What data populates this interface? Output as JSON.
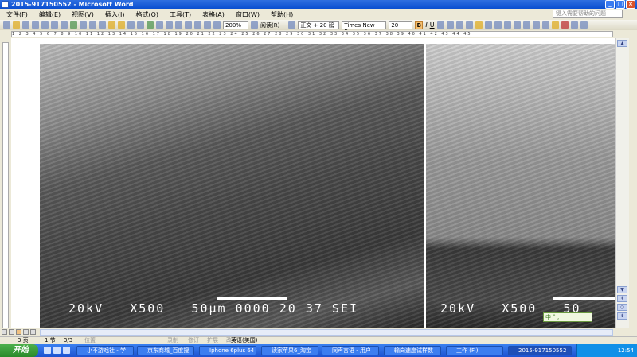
{
  "window": {
    "title": "2015-917150552 - Microsoft Word"
  },
  "menu": [
    "文件(F)",
    "编辑(E)",
    "视图(V)",
    "插入(I)",
    "格式(O)",
    "工具(T)",
    "表格(A)",
    "窗口(W)",
    "帮助(H)"
  ],
  "help_placeholder": "键入需要帮助的问题",
  "toolbar": {
    "zoom": "200%",
    "read": "阅读(R)",
    "style": "正文 + 20 磅",
    "font": "Times New Roman",
    "size": "20",
    "bold": "B",
    "italic": "I",
    "underline": "U"
  },
  "ruler": {
    "ticks": "1 2 3 4 5 6 7 8 9 10 11 12 13 14 15 16 17 18 19 20 21 22 23 24 25 26 27 28 29 30 31 32 33 34 35 36 37 38 39 40 41 42 43 44 45"
  },
  "images": [
    {
      "caption": "20kV   X500   50μm 0000 20 37 SEI"
    },
    {
      "caption": "20kV   X500   50"
    }
  ],
  "ime": "中 ° ,",
  "status": {
    "page": "3 页",
    "section": "1 节",
    "pages": "3/3",
    "position": "位置",
    "rec": "录制",
    "rev": "修订",
    "ext": "扩展",
    "ovr": "改写",
    "lang": "英语(美国)"
  },
  "taskbar": {
    "start": "开始",
    "tasks": [
      "小不游戏社 - 学",
      "京东商城_百度搜",
      "Iphone 6plus 64",
      "读家苹果6_淘宝",
      "同声言语 - 用户",
      "输向速度试样数",
      "工作 (F:)",
      "2015-917150552"
    ],
    "clock": "12:54"
  }
}
